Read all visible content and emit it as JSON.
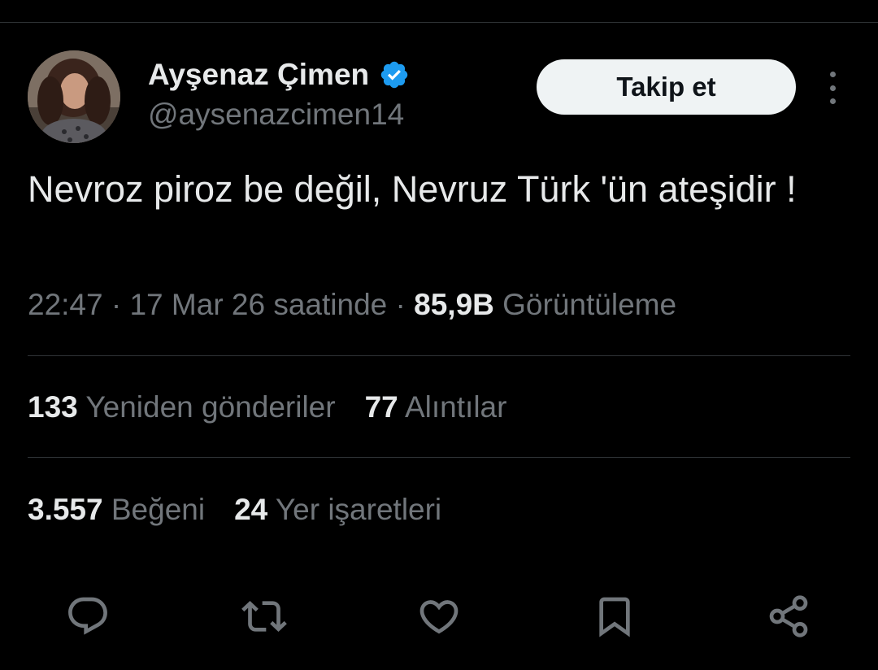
{
  "author": {
    "display_name": "Ayşenaz Çimen",
    "handle": "@aysenazcimen14",
    "verified": true
  },
  "follow_button_label": "Takip et",
  "tweet": {
    "text": "Nevroz piroz be değil, Nevruz Türk 'ün ateşidir !",
    "time": "22:47",
    "date": "17 Mar 26 saatinde",
    "views_count": "85,9B",
    "views_label": "Görüntüleme"
  },
  "stats": {
    "reposts": {
      "count": "133",
      "label": "Yeniden gönderiler"
    },
    "quotes": {
      "count": "77",
      "label": "Alıntılar"
    },
    "likes": {
      "count": "3.557",
      "label": "Beğeni"
    },
    "bookmarks": {
      "count": "24",
      "label": "Yer işaretleri"
    }
  },
  "colors": {
    "background": "#000000",
    "text_primary": "#e7e9ea",
    "text_secondary": "#71767b",
    "divider": "#2f3336",
    "verified_badge": "#1d9bf0",
    "follow_button_bg": "#eff3f4"
  },
  "icons": {
    "more": "more-vertical-icon",
    "reply": "reply-icon",
    "repost": "repost-icon",
    "like": "heart-icon",
    "bookmark": "bookmark-icon",
    "share": "share-icon",
    "verified": "verified-badge-icon"
  }
}
